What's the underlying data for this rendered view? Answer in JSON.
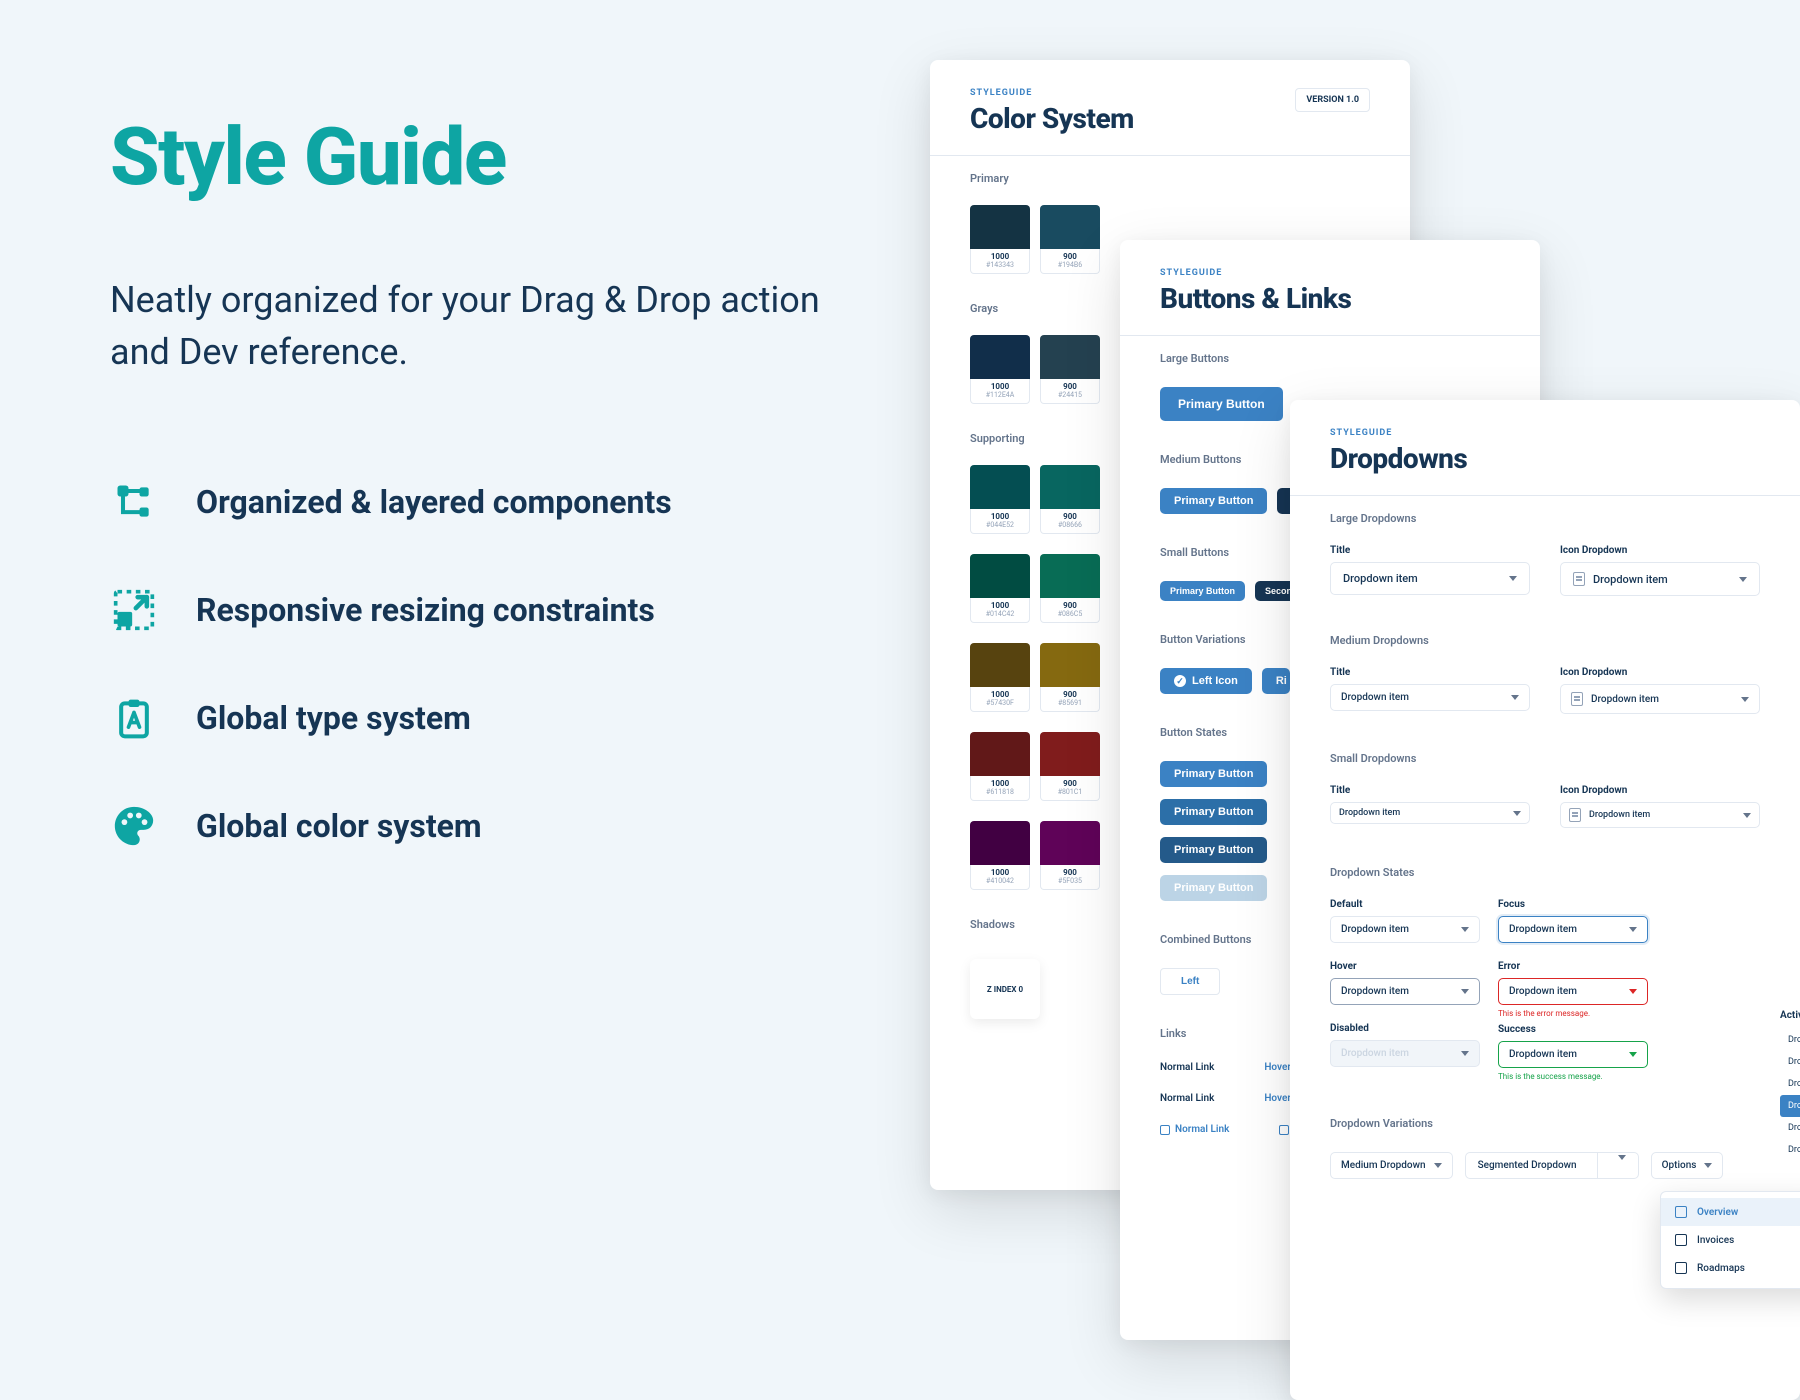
{
  "left": {
    "title": "Style Guide",
    "subtitle": "Neatly organized for your Drag & Drop action and Dev reference.",
    "features": [
      "Organized & layered components",
      "Responsive resizing constraints",
      "Global type system",
      "Global color system"
    ]
  },
  "cards": {
    "color": {
      "eyebrow": "STYLEGUIDE",
      "title": "Color System",
      "version": "VERSION 1.0",
      "sections": {
        "primary": "Primary",
        "grays": "Grays",
        "supporting": "Supporting",
        "shadows": "Shadows"
      },
      "primary_row": [
        {
          "shade": "1000",
          "hex": "#143343",
          "color": "#143343"
        },
        {
          "shade": "900",
          "hex": "#194B6",
          "color": "#194B60"
        }
      ],
      "grays_row": [
        {
          "shade": "1000",
          "hex": "#112E4A",
          "color": "#112E4A"
        },
        {
          "shade": "900",
          "hex": "#24415",
          "color": "#244150"
        }
      ],
      "supporting_rows": [
        [
          {
            "shade": "1000",
            "hex": "#044E52",
            "color": "#044E52"
          },
          {
            "shade": "900",
            "hex": "#08666",
            "color": "#086660"
          }
        ],
        [
          {
            "shade": "1000",
            "hex": "#014C42",
            "color": "#014C42"
          },
          {
            "shade": "900",
            "hex": "#086C5",
            "color": "#086C55"
          }
        ],
        [
          {
            "shade": "1000",
            "hex": "#57430F",
            "color": "#57430F"
          },
          {
            "shade": "900",
            "hex": "#85691",
            "color": "#856910"
          }
        ],
        [
          {
            "shade": "1000",
            "hex": "#611818",
            "color": "#611818"
          },
          {
            "shade": "900",
            "hex": "#801C1",
            "color": "#801C1C"
          }
        ],
        [
          {
            "shade": "1000",
            "hex": "#410042",
            "color": "#410042"
          },
          {
            "shade": "900",
            "hex": "#5F035",
            "color": "#5F0358"
          }
        ]
      ],
      "shadow_label": "Z INDEX 0"
    },
    "buttons": {
      "eyebrow": "STYLEGUIDE",
      "title": "Buttons & Links",
      "sections": {
        "large": "Large Buttons",
        "medium": "Medium Buttons",
        "small": "Small Buttons",
        "variations": "Button Variations",
        "states": "Button States",
        "combined": "Combined Buttons",
        "links": "Links"
      },
      "labels": {
        "primary": "Primary Button",
        "secondary": "Secondary",
        "lefticon": "Left Icon",
        "righticon": "Ri",
        "combined_left": "Left",
        "normal_link": "Normal Link",
        "hovered_link": "Hovered L",
        "hover_link2": "Hover"
      }
    },
    "dropdowns": {
      "eyebrow": "STYLEGUIDE",
      "title": "Dropdowns",
      "sections": {
        "large": "Large Dropdowns",
        "medium": "Medium Dropdowns",
        "small": "Small Dropdowns",
        "states": "Dropdown States",
        "variations": "Dropdown Variations"
      },
      "col_labels": {
        "title": "Title",
        "icon": "Icon Dropdown",
        "default": "Default",
        "focus": "Focus",
        "hover": "Hover",
        "error": "Error",
        "disabled": "Disabled",
        "success": "Success",
        "active": "Active"
      },
      "item": "Dropdown item",
      "error_msg": "This is the error message.",
      "success_msg": "This is the success message.",
      "variations": {
        "medium": "Medium Dropdown",
        "segmented": "Segmented Dropdown",
        "options": "Options"
      },
      "menu": [
        "Overview",
        "Invoices",
        "Roadmaps"
      ],
      "active_list": [
        "Dropdown i",
        "Dropdown i",
        "Dropdown i",
        "Dropdown",
        "Dropdown i",
        "Dropdown i"
      ]
    }
  }
}
